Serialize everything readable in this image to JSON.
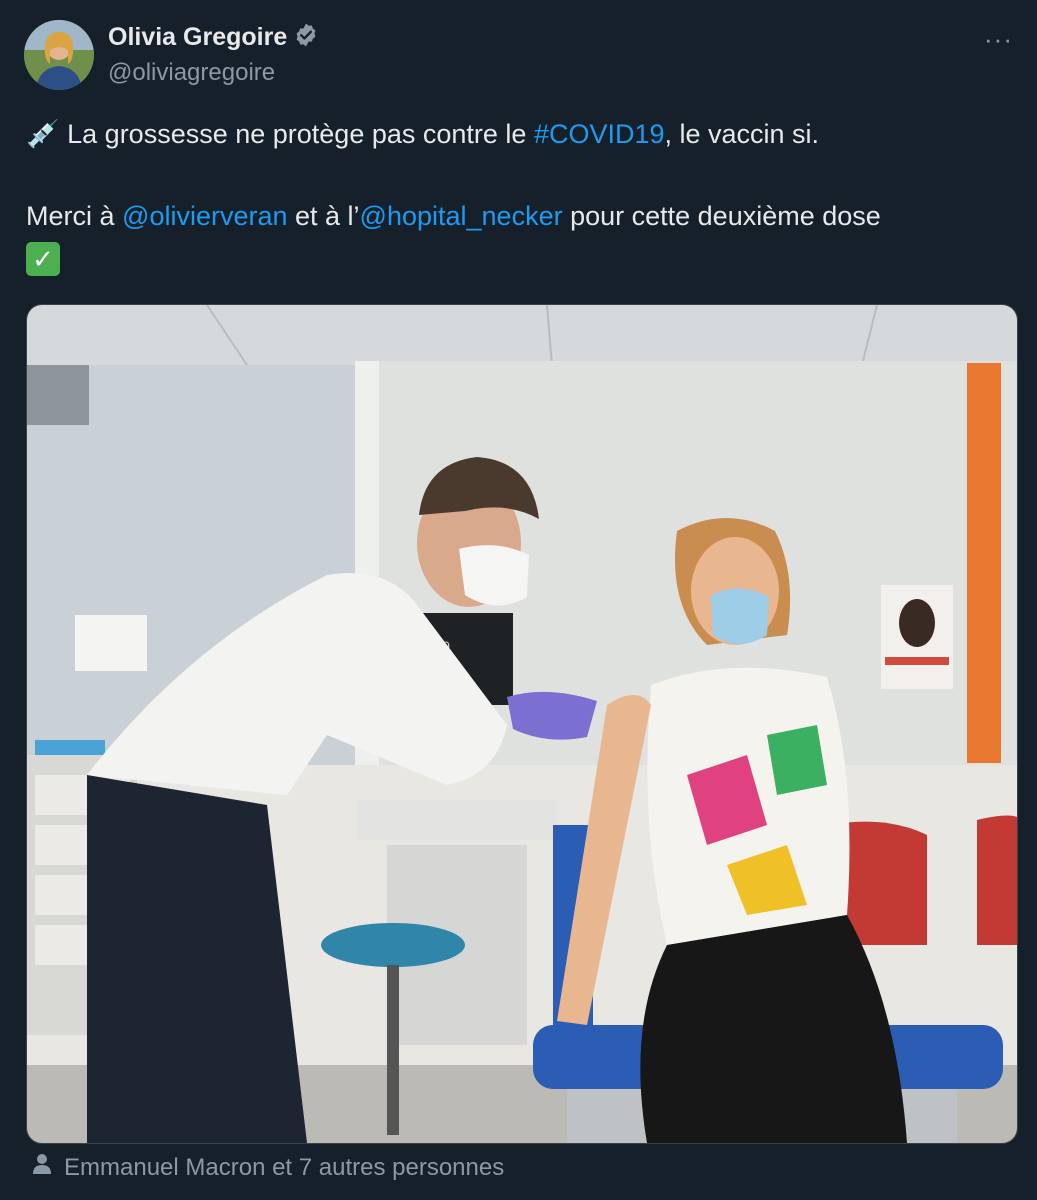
{
  "author": {
    "display_name": "Olivia Gregoire",
    "handle": "@oliviagregoire",
    "verified": true
  },
  "menu": {
    "icon": "more-horizontal-icon",
    "label": "···"
  },
  "tweet": {
    "line1_emoji": "💉",
    "line1_before": "La grossesse ne protège pas contre le ",
    "line1_hashtag": "#COVID19",
    "line1_after": ", le vaccin si.",
    "line2_before": "Merci à ",
    "line2_mention1": "@olivierveran",
    "line2_middle": " et à l’",
    "line2_mention2": "@hopital_necker",
    "line2_after": " pour cette deuxième dose",
    "line3_emoji": "✓"
  },
  "photo": {
    "monitor_text": "W9"
  },
  "tagged_people": "Emmanuel Macron et 7 autres personnes",
  "colors": {
    "background": "#15202b",
    "link": "#1d9bf0",
    "secondary_text": "#8b98a5",
    "verified_badge": "#8b98a5"
  }
}
